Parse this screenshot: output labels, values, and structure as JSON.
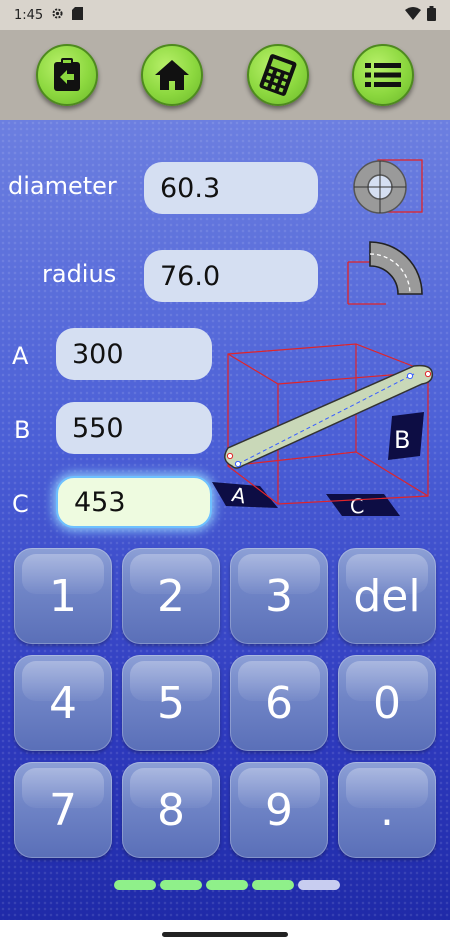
{
  "status_bar": {
    "time": "1:45",
    "icons": [
      "settings-gear-icon",
      "sd-card-icon",
      "wifi-icon",
      "battery-icon"
    ]
  },
  "toolbar": {
    "buttons": [
      {
        "name": "clipboard-back-icon"
      },
      {
        "name": "home-icon"
      },
      {
        "name": "calculator-icon"
      },
      {
        "name": "list-icon"
      }
    ],
    "button_color": "#8cd83f"
  },
  "form": {
    "diameter": {
      "label": "diameter",
      "value": "60.3"
    },
    "radius": {
      "label": "radius",
      "value": "76.0"
    },
    "a": {
      "label": "A",
      "value": "300"
    },
    "b": {
      "label": "B",
      "value": "550"
    },
    "c": {
      "label": "C",
      "value": "453"
    }
  },
  "diagram": {
    "labels": [
      "A",
      "B",
      "C"
    ]
  },
  "keypad": {
    "keys": [
      "1",
      "2",
      "3",
      "del",
      "4",
      "5",
      "6",
      "0",
      "7",
      "8",
      "9",
      "."
    ]
  },
  "progress": {
    "total": 5,
    "completed": 4,
    "done_color": "#8ff08a",
    "todo_color": "#c8cdf0"
  },
  "colors": {
    "background_top": "#6c7fe0",
    "background_bottom": "#1f2aa8",
    "field_bg": "#d5dff2",
    "active_field_bg": "#eefbe0"
  }
}
